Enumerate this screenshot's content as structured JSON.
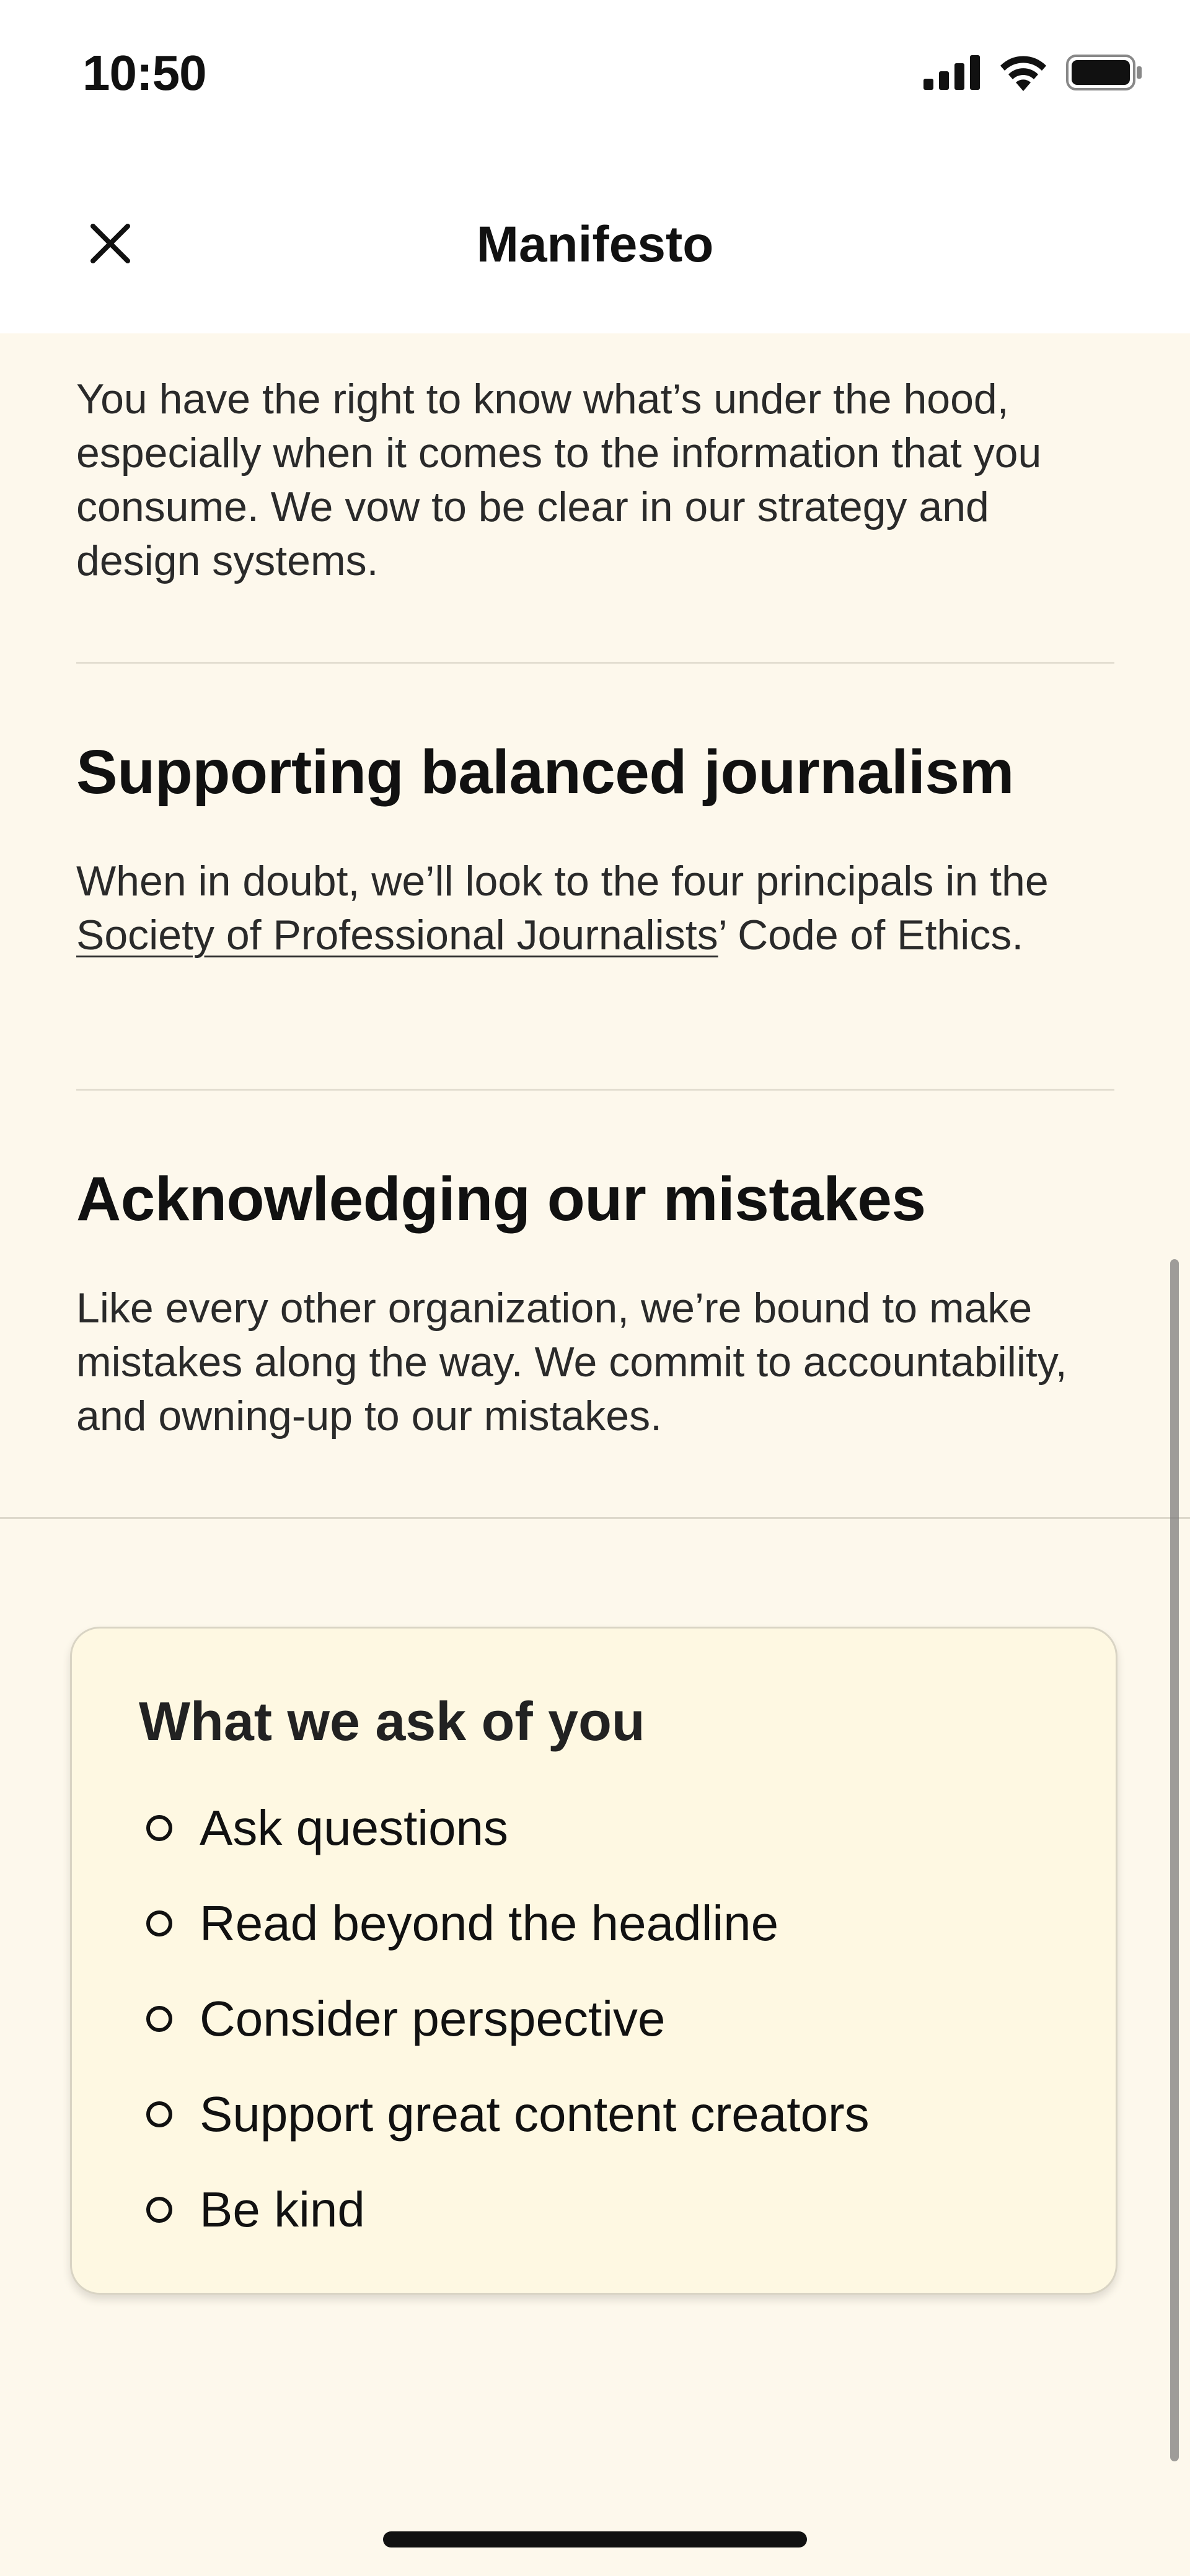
{
  "status_bar": {
    "time": "10:50"
  },
  "nav": {
    "title": "Manifesto",
    "close_icon": "close-icon"
  },
  "sections": {
    "transparency": {
      "body": "You have the right to know what’s under the hood, especially when it comes to the information that you consume. We vow to be clear in our strategy and design systems."
    },
    "balanced": {
      "heading": "Supporting balanced journalism",
      "body_before": "When in doubt, we’ll look to the four principals in the ",
      "link": "Society of Professional Journalists",
      "body_after": "’ Code of Ethics."
    },
    "mistakes": {
      "heading": "Acknowledging our mistakes",
      "body": "Like every other organization, we’re bound to make mistakes along the way. We commit to accountability, and owning-up to our mistakes."
    }
  },
  "ask": {
    "title": "What we ask of you",
    "items": [
      "Ask questions",
      "Read beyond the headline",
      "Consider perspective",
      "Support great content creators",
      "Be kind"
    ]
  },
  "colors": {
    "background": "#FDF8EC",
    "card_background": "#FEF8E2",
    "header_background": "#FFFFFF",
    "text": "#111111"
  }
}
